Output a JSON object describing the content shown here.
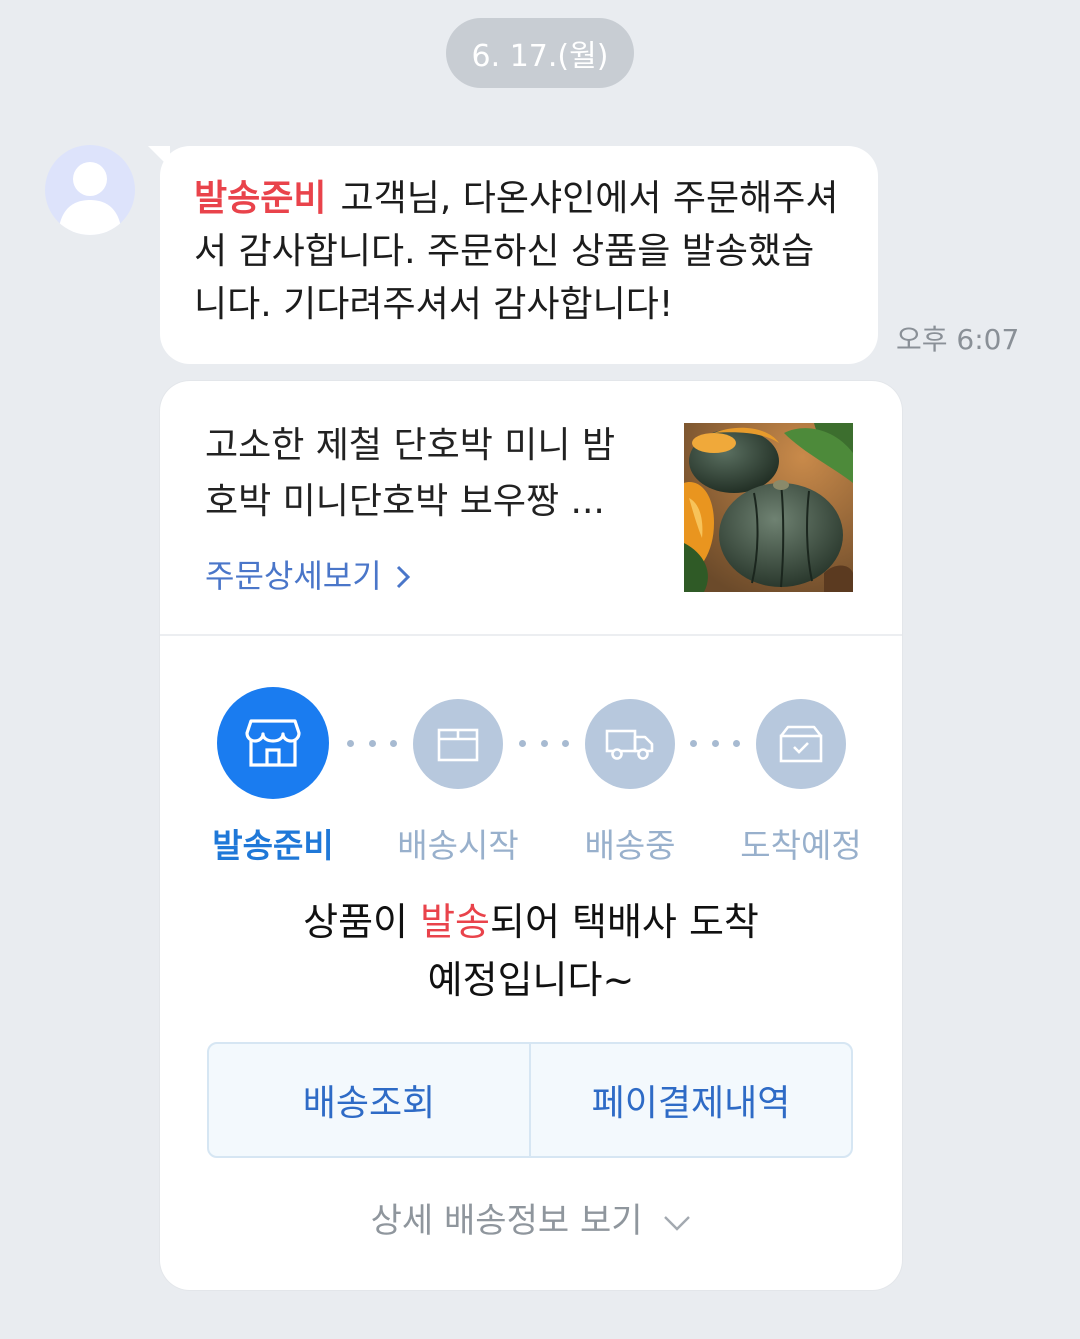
{
  "date_label": "6. 17.(월)",
  "message": {
    "tag": "발송준비",
    "text": "고객님, 다온샤인에서 주문해주셔서 감사합니다. 주문하신 상품을 발송했습니다. 기다려주셔서 감사합니다!",
    "time": "오후 6:07"
  },
  "card": {
    "product_title_line1": "고소한 제철 단호박 미니 밤",
    "product_title_line2": "호박 미니단호박 보우짱 ...",
    "detail_link": "주문상세보기",
    "steps": [
      {
        "label": "발송준비",
        "icon": "store-icon",
        "active": true
      },
      {
        "label": "배송시작",
        "icon": "box-icon",
        "active": false
      },
      {
        "label": "배송중",
        "icon": "truck-icon",
        "active": false
      },
      {
        "label": "도착예정",
        "icon": "package-check-icon",
        "active": false
      }
    ],
    "status_message_pre": "상품이 ",
    "status_message_hl": "발송",
    "status_message_post": "되어 택배사 도착",
    "status_message_line2": "예정입니다~",
    "buttons": {
      "tracking": "배송조회",
      "payment": "페이결제내역"
    },
    "more_info": "상세 배송정보 보기"
  },
  "colors": {
    "accent_blue": "#1a7cf0",
    "tag_red": "#e9434b",
    "inactive_step": "#b7c8dd",
    "background": "#e9ecf0"
  }
}
